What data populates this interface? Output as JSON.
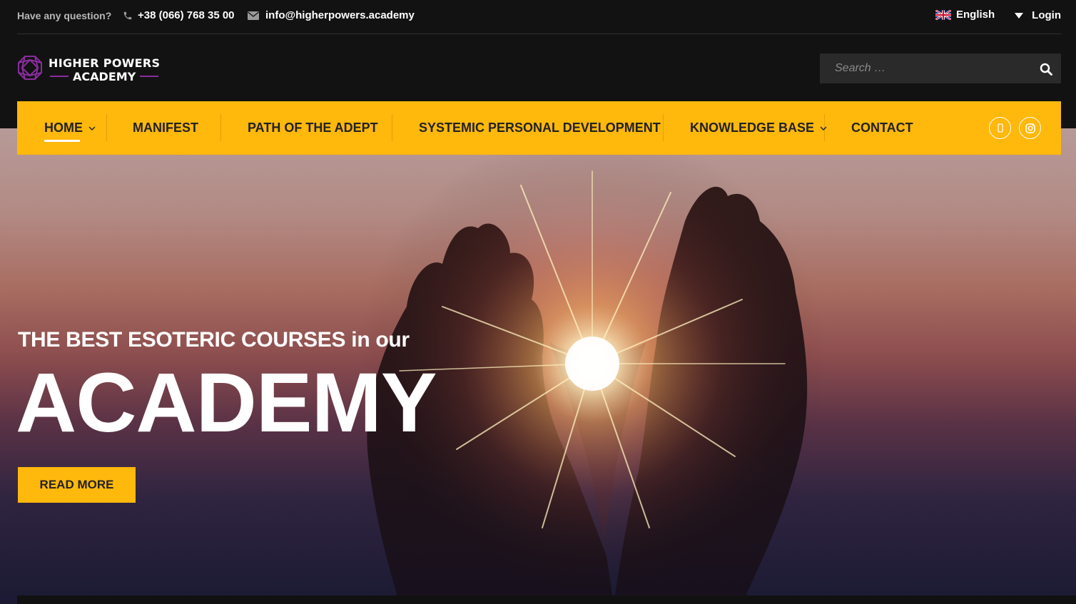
{
  "topbar": {
    "question": "Have any question?",
    "phone": "+38 (066) 768 35 00",
    "email": "info@higherpowers.academy",
    "language": "English",
    "login": "Login",
    "phone_icon": "phone-icon",
    "email_icon": "envelope-icon",
    "flag_icon": "uk-flag-icon"
  },
  "logo": {
    "line1": "HIGHER POWERS",
    "line2": "ACADEMY",
    "icon": "gem-icon",
    "accent_color": "#8a2c9e"
  },
  "search": {
    "placeholder": "Search …",
    "icon": "search-icon"
  },
  "nav": {
    "background": "#ffb80c",
    "items": [
      {
        "label": "HOME",
        "active": true,
        "has_dropdown": true
      },
      {
        "label": "MANIFEST",
        "active": false,
        "has_dropdown": false
      },
      {
        "label": "PATH OF THE ADEPT",
        "active": false,
        "has_dropdown": false
      },
      {
        "label": "SYSTEMIC PERSONAL DEVELOPMENT",
        "active": false,
        "has_dropdown": false
      },
      {
        "label": "KNOWLEDGE BASE",
        "active": false,
        "has_dropdown": true
      },
      {
        "label": "CONTACT",
        "active": false,
        "has_dropdown": false
      }
    ],
    "social": [
      {
        "icon": "facebook-icon"
      },
      {
        "icon": "instagram-icon"
      }
    ]
  },
  "hero": {
    "subtitle_bold": "THE BEST ESOTERIC COURSES",
    "subtitle_rest": "in our",
    "title": "ACADEMY",
    "button": "READ MORE"
  }
}
